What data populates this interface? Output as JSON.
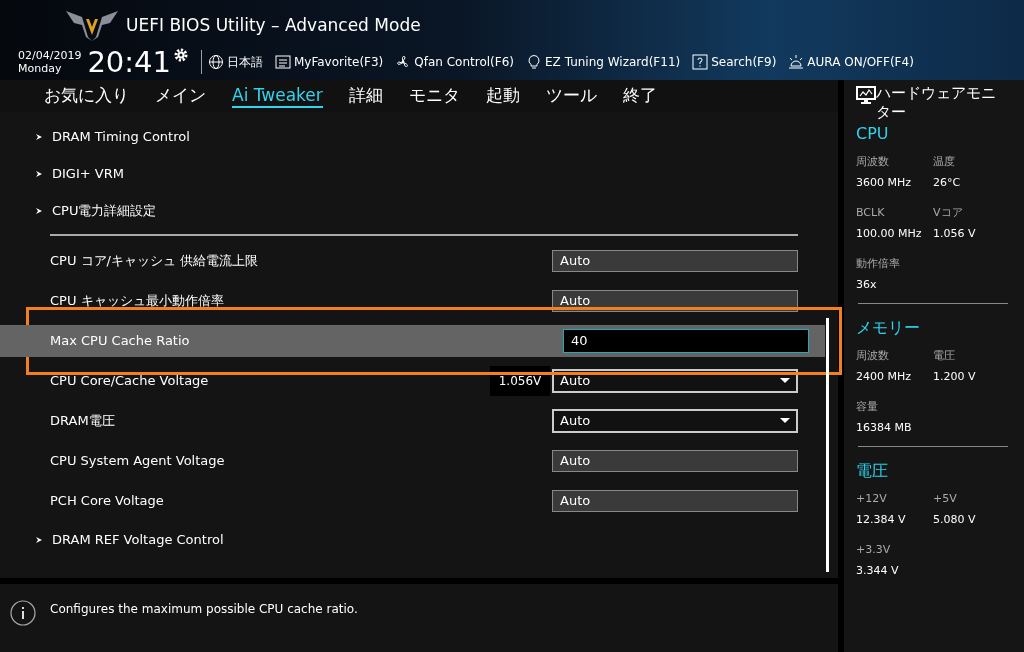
{
  "header": {
    "title": "UEFI BIOS Utility – Advanced Mode",
    "date": "02/04/2019",
    "day": "Monday",
    "time": "20:41",
    "tools": [
      {
        "kind": "language",
        "label": "日本語"
      },
      {
        "kind": "favorite",
        "label": "MyFavorite(F3)"
      },
      {
        "kind": "fan",
        "label": "Qfan Control(F6)"
      },
      {
        "kind": "wizard",
        "label": "EZ Tuning Wizard(F11)"
      },
      {
        "kind": "search",
        "label": "Search(F9)"
      },
      {
        "kind": "aura",
        "label": "AURA ON/OFF(F4)"
      }
    ]
  },
  "tabs": [
    {
      "label": "お気に入り",
      "selected": false
    },
    {
      "label": "メイン",
      "selected": false
    },
    {
      "label": "Ai Tweaker",
      "selected": true
    },
    {
      "label": "詳細",
      "selected": false
    },
    {
      "label": "モニタ",
      "selected": false
    },
    {
      "label": "起動",
      "selected": false
    },
    {
      "label": "ツール",
      "selected": false
    },
    {
      "label": "終了",
      "selected": false
    }
  ],
  "settings": [
    {
      "kind": "submenu",
      "label": "DRAM Timing Control"
    },
    {
      "kind": "submenu",
      "label": "DIGI+ VRM"
    },
    {
      "kind": "submenu",
      "label": "CPU電力詳細設定"
    },
    {
      "kind": "separator"
    },
    {
      "kind": "text",
      "label": "CPU コア/キャッシュ 供給電流上限",
      "value": "Auto",
      "selected": false
    },
    {
      "kind": "text",
      "label": "CPU キャッシュ最小動作倍率",
      "value": "Auto",
      "selected": false
    },
    {
      "kind": "input",
      "label": "Max CPU Cache Ratio",
      "value": "40",
      "selected": true
    },
    {
      "kind": "dropdown",
      "label": "CPU Core/Cache Voltage",
      "reading": "1.056V",
      "value": "Auto",
      "selected": false
    },
    {
      "kind": "dropdown",
      "label": "DRAM電圧",
      "value": "Auto",
      "selected": false
    },
    {
      "kind": "text",
      "label": "CPU System Agent Voltage",
      "value": "Auto",
      "selected": false
    },
    {
      "kind": "text",
      "label": "PCH Core Voltage",
      "value": "Auto",
      "selected": false
    },
    {
      "kind": "submenu",
      "label": "DRAM REF Voltage Control"
    }
  ],
  "help_text": "Configures the maximum possible CPU cache ratio.",
  "hardware_monitor": {
    "title": "ハードウェアモニター",
    "sections": [
      {
        "title": "CPU",
        "items": [
          {
            "label": "周波数",
            "value": "3600 MHz"
          },
          {
            "label": "温度",
            "value": "26°C"
          },
          {
            "label": "BCLK",
            "value": "100.00 MHz"
          },
          {
            "label": "Vコア",
            "value": "1.056 V"
          },
          {
            "label": "動作倍率",
            "value": "36x"
          }
        ]
      },
      {
        "title": "メモリー",
        "items": [
          {
            "label": "周波数",
            "value": "2400 MHz"
          },
          {
            "label": "電圧",
            "value": "1.200 V"
          },
          {
            "label": "容量",
            "value": "16384 MB"
          }
        ]
      },
      {
        "title": "電圧",
        "items": [
          {
            "label": "+12V",
            "value": "12.384 V"
          },
          {
            "label": "+5V",
            "value": "5.080 V"
          },
          {
            "label": "+3.3V",
            "value": "3.344 V"
          }
        ]
      }
    ]
  }
}
